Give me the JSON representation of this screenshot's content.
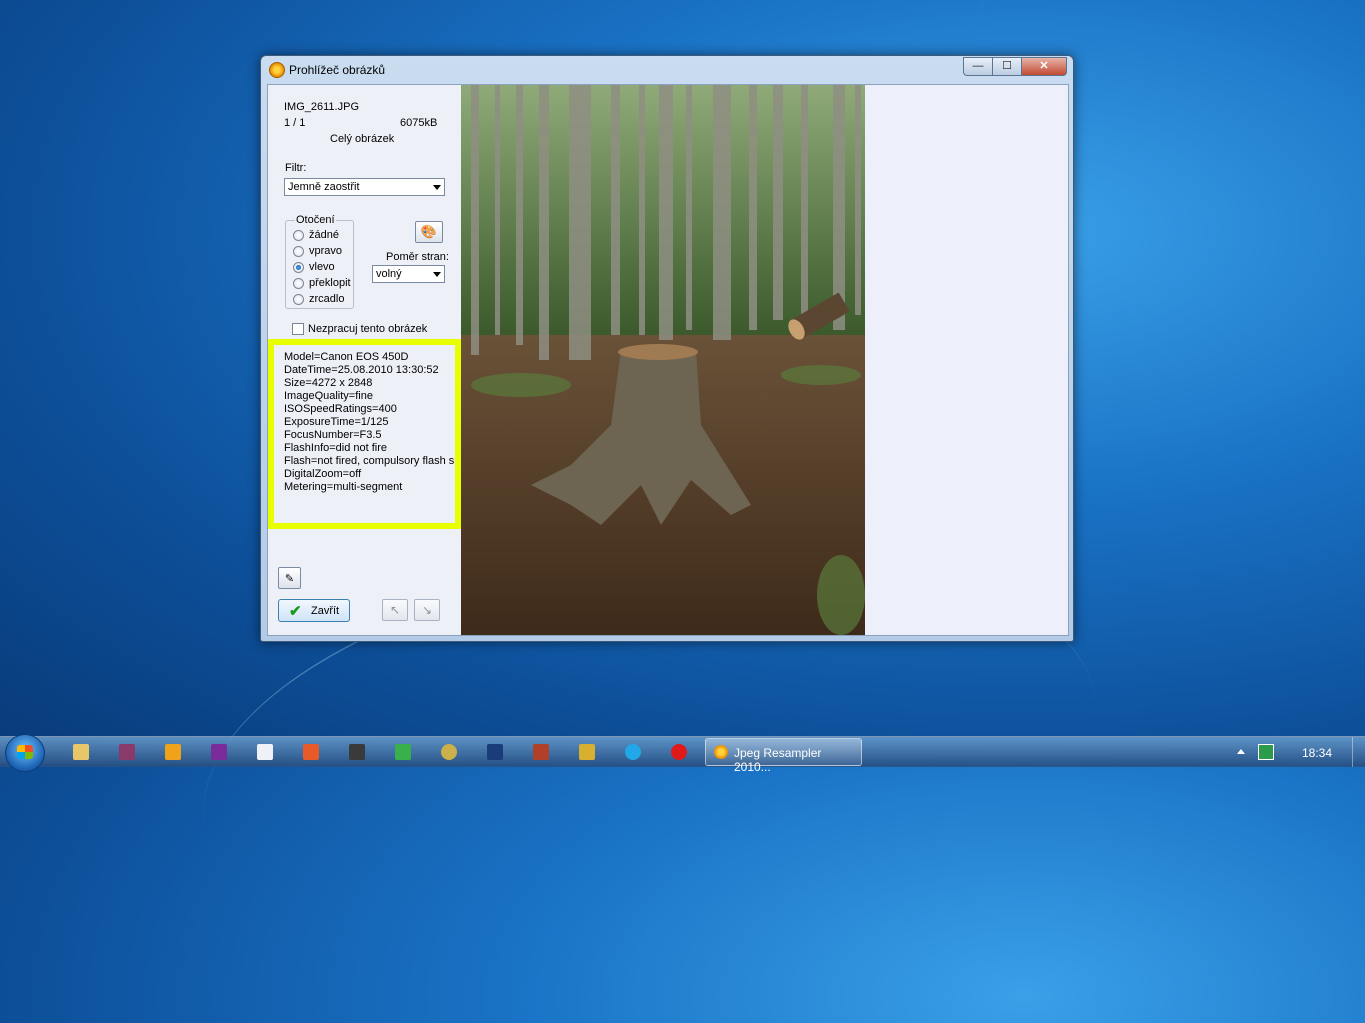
{
  "window": {
    "title": "Prohlížeč obrázků",
    "buttons": {
      "minimize": "—",
      "maximize": "☐",
      "close": "✕"
    }
  },
  "file": {
    "name": "IMG_2611.JPG",
    "index": "1 / 1",
    "size": "6075kB",
    "view_mode": "Celý obrázek"
  },
  "filter": {
    "label": "Filtr:",
    "selected": "Jemně zaostřit"
  },
  "rotation": {
    "legend": "Otočení",
    "options": [
      "žádné",
      "vpravo",
      "vlevo",
      "překlopit",
      "zrcadlo"
    ],
    "selected_index": 2
  },
  "aspect": {
    "label": "Poměr stran:",
    "selected": "volný"
  },
  "skip_checkbox": {
    "label": "Nezpracuj tento obrázek",
    "checked": false
  },
  "exif": [
    "Model=Canon EOS 450D",
    "DateTime=25.08.2010  13:30:52",
    "Size=4272 x 2848",
    "ImageQuality=fine",
    "ISOSpeedRatings=400",
    "ExposureTime=1/125",
    "FocusNumber=F3.5",
    "FlashInfo=did not fire",
    "Flash=not fired, compulsory flash sup",
    "DigitalZoom=off",
    "Metering=multi-segment"
  ],
  "actions": {
    "close_label": "Zavřít"
  },
  "taskbar": {
    "active_task": "Jpeg Resampler 2010...",
    "clock": "18:34",
    "pinned_icons": [
      "explorer-icon",
      "save-icon",
      "media-player-icon",
      "app-icon",
      "word-icon",
      "app-icon",
      "calculator-icon",
      "app-icon",
      "jpeg-resampler-icon",
      "photoshop-icon",
      "app-icon",
      "app-icon",
      "skype-icon",
      "opera-icon"
    ]
  },
  "colors": {
    "highlight": "#e8ff00",
    "desktop": "#1a73c6"
  }
}
